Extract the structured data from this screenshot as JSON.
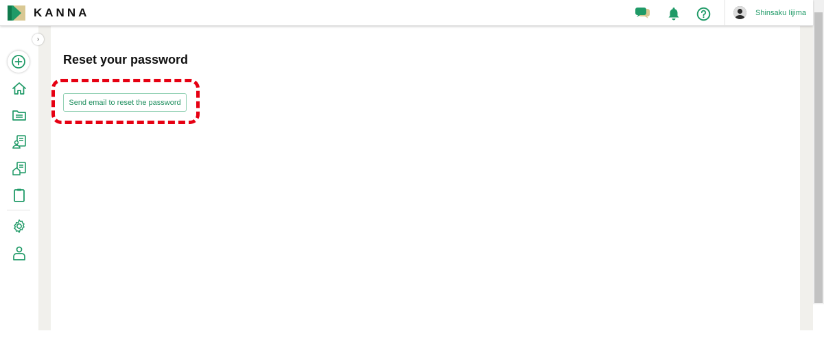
{
  "app": {
    "brand": "KANNA",
    "accent_color": "#1f9a67",
    "highlight_color": "#e60012"
  },
  "header": {
    "icons": [
      "chat-icon",
      "bell-icon",
      "help-icon"
    ],
    "user_name": "Shinsaku Iijima"
  },
  "sidebar": {
    "items": [
      {
        "icon": "add-icon"
      },
      {
        "icon": "home-icon"
      },
      {
        "icon": "folder-icon"
      },
      {
        "icon": "customer-list-icon"
      },
      {
        "icon": "property-list-icon"
      },
      {
        "icon": "clipboard-icon"
      },
      {
        "icon": "settings-icon"
      },
      {
        "icon": "account-icon"
      }
    ]
  },
  "page": {
    "title": "Reset your password",
    "send_button_label": "Send email to reset the password"
  }
}
